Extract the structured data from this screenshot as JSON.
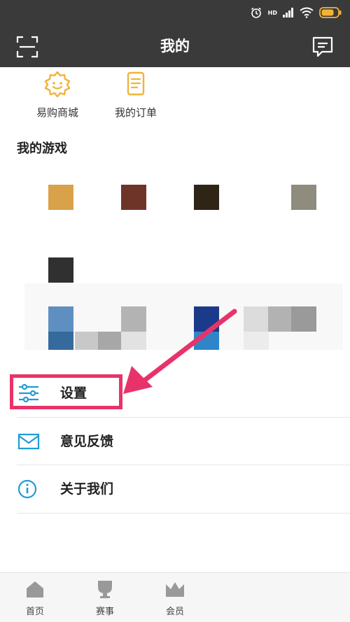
{
  "status_bar": {
    "hd_label": "HD"
  },
  "header": {
    "title": "我的"
  },
  "shortcuts": [
    {
      "label": "易购商城"
    },
    {
      "label": "我的订单"
    }
  ],
  "games_section": {
    "title": "我的游戏"
  },
  "menu": [
    {
      "label": "设置"
    },
    {
      "label": "意见反馈"
    },
    {
      "label": "关于我们"
    }
  ],
  "bottom_nav": [
    {
      "label": "首页"
    },
    {
      "label": "赛事"
    },
    {
      "label": "会员"
    }
  ],
  "colors": {
    "header_bg": "#3a3a3a",
    "accent_gold": "#f0b33a",
    "accent_blue": "#1e9bd7",
    "highlight_pink": "#e8336a"
  }
}
